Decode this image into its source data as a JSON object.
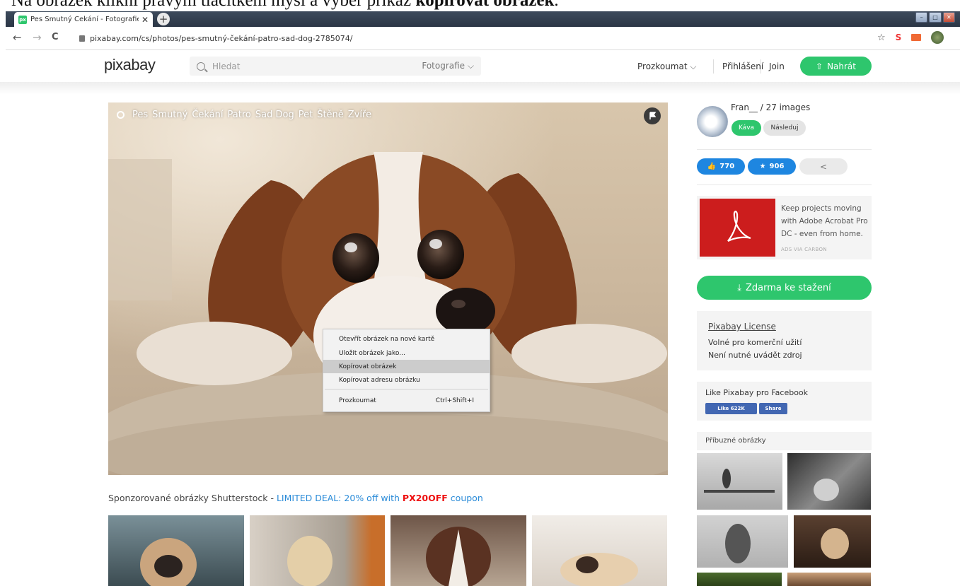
{
  "instruction": {
    "text_before": "Na obrázek klikni pravým tlačítkem myši a vyber příkaz ",
    "text_bold": "kopírovat obrázek",
    "text_after": "."
  },
  "browser": {
    "tab_title": "Pes Smutný Čekání - Fotografie z",
    "tab_favicon": "px",
    "url": "pixabay.com/cs/photos/pes-smutný-čekání-patro-sad-dog-2785074/",
    "back_icon": "←",
    "forward_icon": "→",
    "reload_icon": "C",
    "star_icon": "☆",
    "ext_s": "S"
  },
  "header": {
    "logo": "pixabay",
    "search_placeholder": "Hledat",
    "search_category": "Fotografie",
    "explore": "Prozkoumat",
    "login": "Přihlášení",
    "join": "Join",
    "upload": "Nahrát"
  },
  "photo": {
    "tags": [
      "Pes",
      "Smutný",
      "Čekání",
      "Patro",
      "Sad Dog",
      "Pet",
      "Štěně",
      "Zvíře"
    ]
  },
  "context_menu": {
    "items": [
      {
        "label": "Otevřít obrázek na nové kartě",
        "shortcut": ""
      },
      {
        "label": "Uložit obrázek jako...",
        "shortcut": ""
      },
      {
        "label": "Kopírovat obrázek",
        "shortcut": ""
      },
      {
        "label": "Kopírovat adresu obrázku",
        "shortcut": ""
      },
      {
        "label": "Prozkoumat",
        "shortcut": "Ctrl+Shift+I"
      }
    ]
  },
  "sidebar": {
    "user_line": "Fran__ / 27 images",
    "coffee_button": "Káva",
    "follow_button": "Následuj",
    "likes": "770",
    "favorites": "906",
    "ad": {
      "text": "Keep projects moving with Adobe Acrobat Pro DC - even from home.",
      "via": "ADS VIA CARBON"
    },
    "download": "Zdarma ke stažení",
    "license": {
      "title": "Pixabay License",
      "line1": "Volné pro komerční užití",
      "line2": "Není nutné uvádět zdroj"
    },
    "facebook": {
      "text": "Like Pixabay pro Facebook",
      "like_button": "Like 622K",
      "share_button": "Share"
    },
    "related_title": "Příbuzné obrázky"
  },
  "sponsored": {
    "prefix": "Sponzorované obrázky Shutterstock - ",
    "deal": "LIMITED DEAL: 20% off with ",
    "code": "PX20OFF",
    "suffix": " coupon"
  },
  "colors": {
    "accent_green": "#2ec66d",
    "stat_blue": "#1e86e0",
    "deal_blue": "#2a8bd8",
    "coupon_red": "#ee1111",
    "facebook_blue": "#4267b2",
    "adobe_red": "#cc1d1d"
  }
}
